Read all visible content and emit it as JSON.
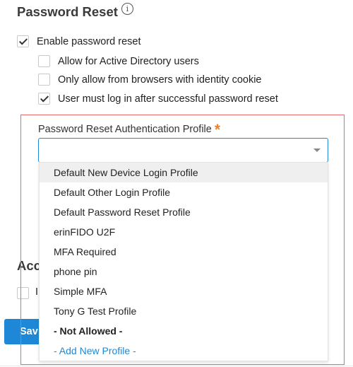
{
  "section": {
    "title": "Password Reset",
    "info_icon": "i"
  },
  "checkboxes": [
    {
      "label": "Enable password reset",
      "checked": true
    },
    {
      "label": "Allow for Active Directory users",
      "checked": false
    },
    {
      "label": "Only allow from browsers with identity cookie",
      "checked": false
    },
    {
      "label": "User must log in after successful password reset",
      "checked": true
    }
  ],
  "auth_profile": {
    "label": "Password Reset Authentication Profile",
    "required_mark": "*",
    "value": "",
    "options": [
      "Default New Device Login Profile",
      "Default Other Login Profile",
      "Default Password Reset Profile",
      "erinFIDO U2F",
      "MFA Required",
      "phone pin",
      "Simple MFA",
      "Tony G Test Profile",
      "- Not Allowed -",
      "- Add New Profile -"
    ],
    "hovered_option": "Default New Device Login Profile"
  },
  "partially_hidden": {
    "heading_fragment": "Acc",
    "checkbox_label_fragment": "I",
    "button_fragment": "Sav"
  },
  "colors": {
    "accent": "#1e88d6",
    "required": "#f0812b",
    "highlight_border": "#e36a6a",
    "hover_bg": "#efefef"
  }
}
